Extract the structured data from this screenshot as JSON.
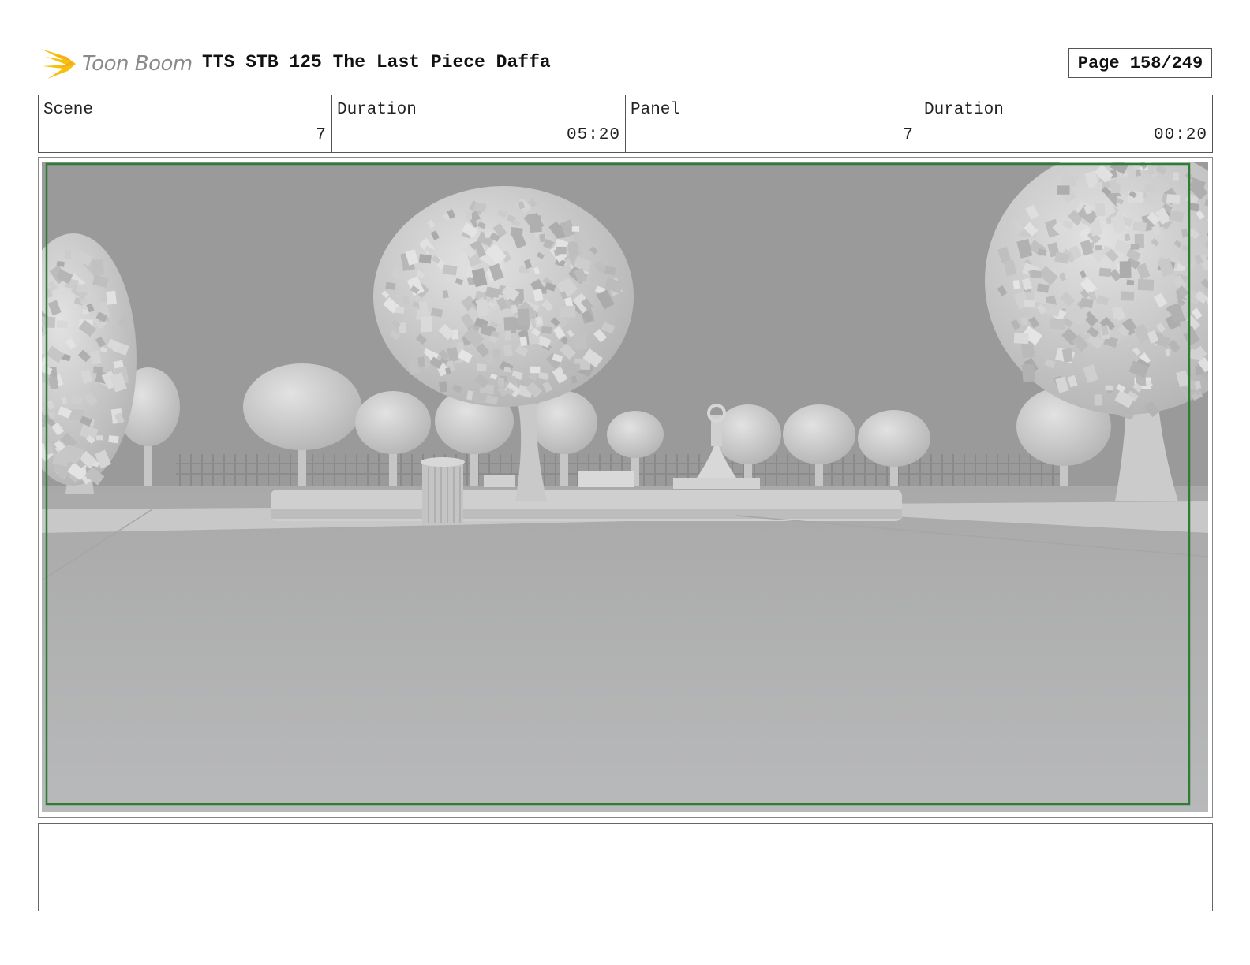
{
  "header": {
    "logo_text": "Toon Boom",
    "title": "TTS STB 125 The Last Piece Daffa",
    "page": "Page 158/249"
  },
  "info": {
    "scene_label": "Scene",
    "scene_value": "7",
    "scene_duration_label": "Duration",
    "scene_duration_value": "05:20",
    "panel_label": "Panel",
    "panel_value": "7",
    "panel_duration_label": "Duration",
    "panel_duration_value": "00:20"
  },
  "panel": {
    "safe_frame_color": "#2e7d32",
    "sky_color": "#9a9a9a",
    "ground_color": "#b3b3b3"
  },
  "notes": {
    "text": ""
  }
}
